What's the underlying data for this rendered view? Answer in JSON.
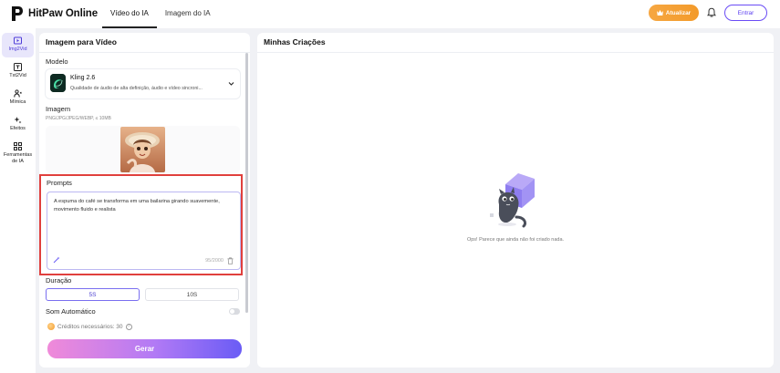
{
  "app": {
    "name": "HitPaw Online"
  },
  "header": {
    "tabs": [
      {
        "label": "Vídeo do IA",
        "active": true
      },
      {
        "label": "Imagem do IA",
        "active": false
      }
    ],
    "upgrade_label": "Atualizar",
    "login_label": "Entrar"
  },
  "sidebar": {
    "items": [
      {
        "label": "Img2Vid",
        "active": true
      },
      {
        "label": "Txt2Vid",
        "active": false
      },
      {
        "label": "Mímica",
        "active": false
      },
      {
        "label": "Efeitos",
        "active": false
      },
      {
        "label": "Ferramentas de IA",
        "active": false
      }
    ]
  },
  "left_panel": {
    "title": "Imagem para Vídeo",
    "model_label": "Modelo",
    "model": {
      "name": "Kling 2.6",
      "description": "Qualidade de áudio de alta definição, áudio e vídeo sincroni..."
    },
    "image_label": "Imagem",
    "image_hint": "PNG/JPG/JPEG/WEBP, ≤ 10MB",
    "prompts_label": "Prompts",
    "prompt_text": "A espuma do café se transforma em uma bailarina girando suavemente, movimento fluido e realista",
    "prompt_count": "95/2000",
    "duration_label": "Duração",
    "durations": [
      "5S",
      "10S"
    ],
    "selected_duration": "5S",
    "auto_sound_label": "Som Automático",
    "auto_sound_on": false,
    "credits_text": "Créditos necessários: 30",
    "generate_label": "Gerar"
  },
  "right_panel": {
    "title": "Minhas Criações",
    "empty_message": "Ops! Parece que ainda não foi criado nada."
  },
  "colors": {
    "accent": "#5b3ff0",
    "upgrade": "#f39a2a",
    "highlight_border": "#e0403d"
  }
}
